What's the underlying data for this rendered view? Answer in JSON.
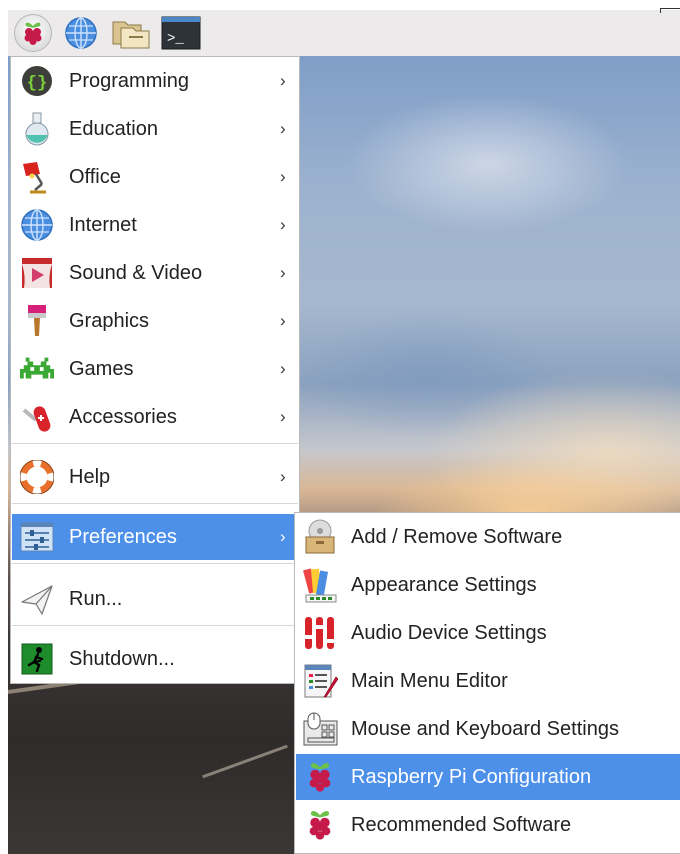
{
  "taskbar": {
    "buttons": [
      {
        "name": "raspberry-menu",
        "icon": "raspberry-icon"
      },
      {
        "name": "web-browser",
        "icon": "globe-icon"
      },
      {
        "name": "file-manager",
        "icon": "folder-icon"
      },
      {
        "name": "terminal",
        "icon": "terminal-icon",
        "text": ">_"
      }
    ]
  },
  "menu": {
    "items": [
      {
        "label": "Programming",
        "icon": "code-braces-icon",
        "has_submenu": true
      },
      {
        "label": "Education",
        "icon": "flask-icon",
        "has_submenu": true
      },
      {
        "label": "Office",
        "icon": "desk-lamp-icon",
        "has_submenu": true
      },
      {
        "label": "Internet",
        "icon": "globe-icon",
        "has_submenu": true
      },
      {
        "label": "Sound & Video",
        "icon": "theater-icon",
        "has_submenu": true
      },
      {
        "label": "Graphics",
        "icon": "paintbrush-icon",
        "has_submenu": true
      },
      {
        "label": "Games",
        "icon": "space-invader-icon",
        "has_submenu": true
      },
      {
        "label": "Accessories",
        "icon": "swiss-knife-icon",
        "has_submenu": true
      },
      {
        "label": "Help",
        "icon": "lifebuoy-icon",
        "has_submenu": true
      },
      {
        "label": "Preferences",
        "icon": "sliders-icon",
        "has_submenu": true,
        "selected": true
      },
      {
        "label": "Run...",
        "icon": "paper-plane-icon",
        "has_submenu": false
      },
      {
        "label": "Shutdown...",
        "icon": "exit-icon",
        "has_submenu": false
      }
    ],
    "arrow": "›"
  },
  "submenu": {
    "items": [
      {
        "label": "Add / Remove Software",
        "icon": "package-icon"
      },
      {
        "label": "Appearance Settings",
        "icon": "palette-icon"
      },
      {
        "label": "Audio Device Settings",
        "icon": "mixer-icon"
      },
      {
        "label": "Main Menu Editor",
        "icon": "menu-editor-icon"
      },
      {
        "label": "Mouse and Keyboard Settings",
        "icon": "keyboard-mouse-icon"
      },
      {
        "label": "Raspberry Pi Configuration",
        "icon": "raspberry-icon",
        "selected": true
      },
      {
        "label": "Recommended Software",
        "icon": "raspberry-icon"
      }
    ]
  },
  "colors": {
    "selection": "#4d90ea",
    "panel": "#eceaea",
    "raspberry": "#c51a4a",
    "leaf": "#6cc04a"
  }
}
